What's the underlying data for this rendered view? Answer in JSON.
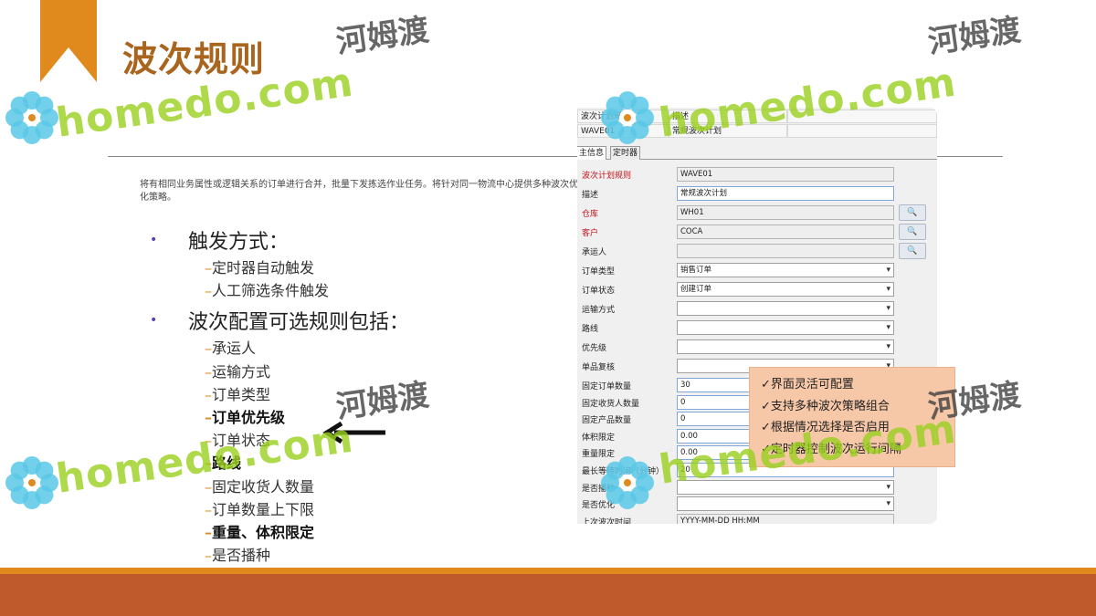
{
  "slide": {
    "title": "波次规则",
    "intro": "将有相同业务属性或逻辑关系的订单进行合并，批量下发拣选作业任务。将针对同一物流中心提供多种波次优化策略。"
  },
  "bullets": [
    {
      "label": "触发方式：",
      "subitems": [
        "定时器自动触发",
        "人工筛选条件触发"
      ]
    },
    {
      "label": "波次配置可选规则包括：",
      "subitems": [
        "承运人",
        "运输方式",
        "订单类型",
        "订单优先级",
        "订单状态",
        "路线",
        "固定收货人数量",
        "订单数量上下限",
        "重量、体积限定",
        "是否播种",
        "……."
      ]
    }
  ],
  "dash": "–",
  "bullet_glyph": "•",
  "app": {
    "header": {
      "col1_label": "波次计划规则",
      "col2_label": "描述",
      "col1_value": "WAVE01",
      "col2_value": "常规波次计划"
    },
    "tabs": [
      "主信息",
      "定时器"
    ],
    "lookup_icon": "magnifier-icon",
    "lookup_glyph": "🔍",
    "fields": [
      {
        "label": "波次计划规则",
        "value": "WAVE01",
        "required": true,
        "kind": "text"
      },
      {
        "label": "描述",
        "value": "常规波次计划",
        "required": false,
        "kind": "editable"
      },
      {
        "label": "仓库",
        "value": "WH01",
        "required": true,
        "kind": "text",
        "lookup": true
      },
      {
        "label": "客户",
        "value": "COCA",
        "required": true,
        "kind": "text",
        "lookup": true
      },
      {
        "label": "承运人",
        "value": "",
        "required": false,
        "kind": "text",
        "lookup": true
      },
      {
        "label": "订单类型",
        "value": "销售订单",
        "required": false,
        "kind": "select"
      },
      {
        "label": "订单状态",
        "value": "创建订单",
        "required": false,
        "kind": "select"
      },
      {
        "label": "运输方式",
        "value": "",
        "required": false,
        "kind": "select"
      },
      {
        "label": "路线",
        "value": "",
        "required": false,
        "kind": "select"
      },
      {
        "label": "优先级",
        "value": "",
        "required": false,
        "kind": "select"
      },
      {
        "label": "单品复核",
        "value": "",
        "required": false,
        "kind": "select"
      },
      {
        "label": "固定订单数量",
        "value": "30",
        "required": false,
        "kind": "editable"
      },
      {
        "label": "固定收货人数量",
        "value": "0",
        "required": false,
        "kind": "editable"
      },
      {
        "label": "固定产品数量",
        "value": "0",
        "required": false,
        "kind": "editable"
      },
      {
        "label": "体积限定",
        "value": "0.00",
        "required": false,
        "kind": "editable"
      },
      {
        "label": "重量限定",
        "value": "0.00",
        "required": false,
        "kind": "editable"
      },
      {
        "label": "最长等待时间（分钟）",
        "value": "20",
        "required": false,
        "kind": "editable"
      },
      {
        "label": "是否播种",
        "value": "",
        "required": false,
        "kind": "select"
      },
      {
        "label": "是否优化",
        "value": "",
        "required": false,
        "kind": "select"
      },
      {
        "label": "上次波次时间",
        "value": "YYYY-MM-DD HH:MM",
        "required": false,
        "kind": "text"
      }
    ]
  },
  "callout": {
    "items": [
      "✓界面灵活可配置",
      "✓支持多种波次策略组合",
      "✓根据情况选择是否启用",
      "✓定时器控制波次运行间隔"
    ]
  },
  "watermark": {
    "latin": "homedo.com",
    "cjk": "河姆渡"
  },
  "colors": {
    "accent_orange": "#e08a1e",
    "title_brown": "#a9651e",
    "band_rust": "#be5a2c",
    "bullet_purple": "#5a3fb0",
    "required_red": "#c0141c",
    "callout_peach": "#f7c8a8",
    "watermark_green": "#98d01e",
    "flower_blue": "#5bc8e6"
  }
}
